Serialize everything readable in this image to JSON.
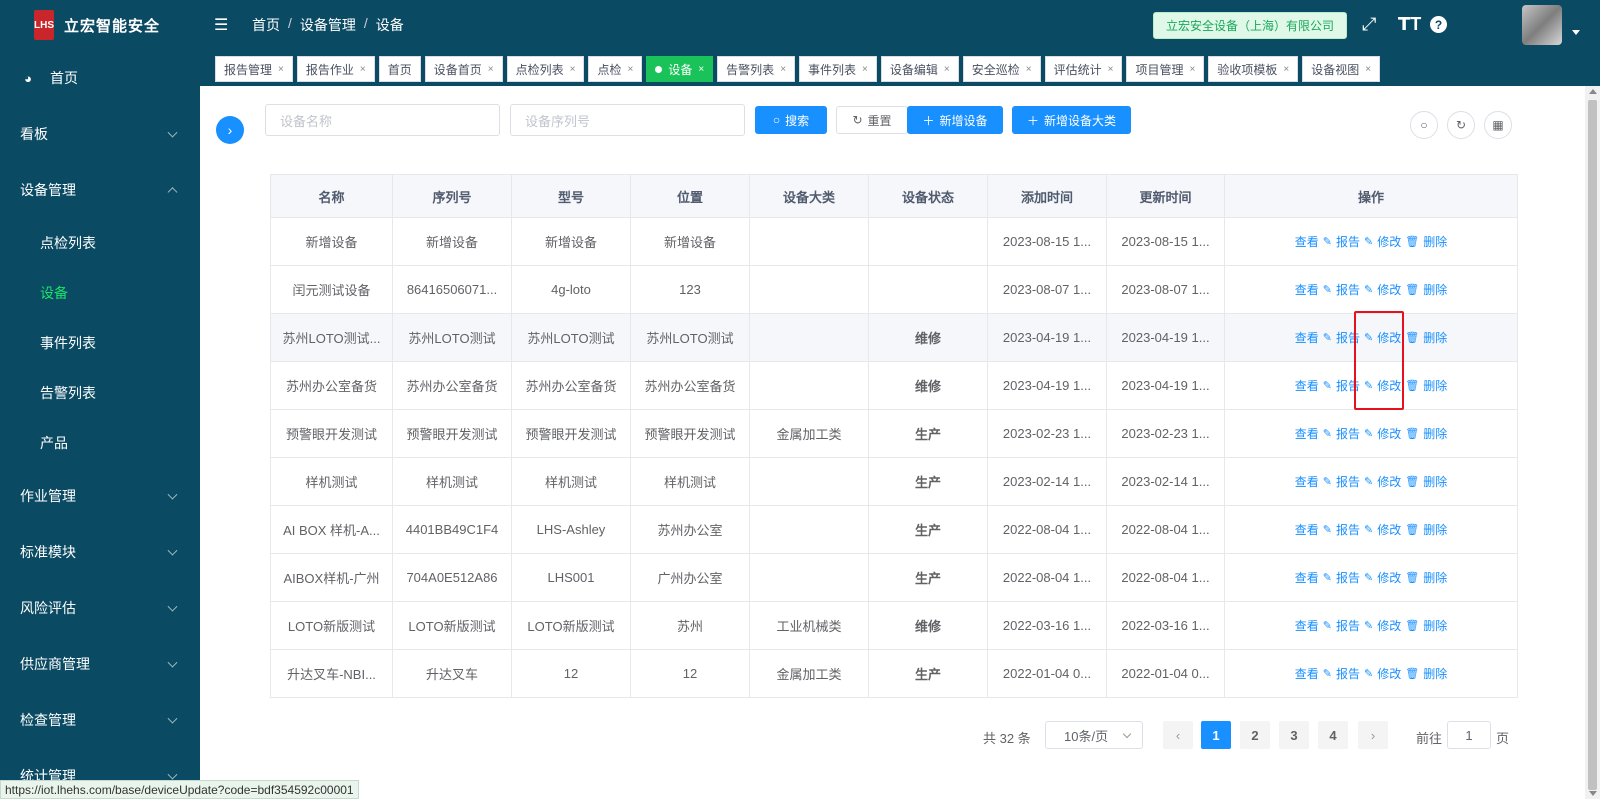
{
  "app": {
    "title": "立宏智能安全",
    "logo_text": "LHS"
  },
  "sidebar": {
    "items": [
      {
        "label": "首页",
        "icon": "dashboard-icon",
        "type": "top"
      },
      {
        "label": "看板",
        "type": "group",
        "expanded": false
      },
      {
        "label": "设备管理",
        "type": "group",
        "expanded": true
      },
      {
        "label": "点检列表",
        "type": "sub"
      },
      {
        "label": "设备",
        "type": "sub",
        "active": true
      },
      {
        "label": "事件列表",
        "type": "sub"
      },
      {
        "label": "告警列表",
        "type": "sub"
      },
      {
        "label": "产品",
        "type": "sub"
      },
      {
        "label": "作业管理",
        "type": "group",
        "expanded": false
      },
      {
        "label": "标准模块",
        "type": "group",
        "expanded": false
      },
      {
        "label": "风险评估",
        "type": "group",
        "expanded": false
      },
      {
        "label": "供应商管理",
        "type": "group",
        "expanded": false
      },
      {
        "label": "检查管理",
        "type": "group",
        "expanded": false
      },
      {
        "label": "统计管理",
        "type": "group",
        "expanded": false
      }
    ]
  },
  "header": {
    "breadcrumb": [
      "首页",
      "设备管理",
      "设备"
    ],
    "company": "立宏安全设备（上海）有限公司"
  },
  "tabs": [
    {
      "label": "报告管理"
    },
    {
      "label": "报告作业"
    },
    {
      "label": "首页",
      "closable": false
    },
    {
      "label": "设备首页"
    },
    {
      "label": "点检列表"
    },
    {
      "label": "点检"
    },
    {
      "label": "设备",
      "active": true
    },
    {
      "label": "告警列表"
    },
    {
      "label": "事件列表"
    },
    {
      "label": "设备编辑"
    },
    {
      "label": "安全巡检"
    },
    {
      "label": "评估统计"
    },
    {
      "label": "项目管理"
    },
    {
      "label": "验收项模板"
    },
    {
      "label": "设备视图"
    }
  ],
  "search": {
    "name_placeholder": "设备名称",
    "serial_placeholder": "设备序列号",
    "search_label": "搜索",
    "reset_label": "重置",
    "add_device_label": "新增设备",
    "add_category_label": "新增设备大类"
  },
  "table": {
    "columns": [
      "名称",
      "序列号",
      "型号",
      "位置",
      "设备大类",
      "设备状态",
      "添加时间",
      "更新时间",
      "操作"
    ],
    "ops": {
      "view": "查看",
      "report": "报告",
      "edit": "修改",
      "delete": "删除"
    },
    "rows": [
      [
        "新增设备",
        "新增设备",
        "新增设备",
        "新增设备",
        "",
        "",
        "2023-08-15 1...",
        "2023-08-15 1..."
      ],
      [
        "闰元测试设备",
        "86416506071...",
        "4g-loto",
        "123",
        "",
        "",
        "2023-08-07 1...",
        "2023-08-07 1..."
      ],
      [
        "苏州LOTO测试...",
        "苏州LOTO测试",
        "苏州LOTO测试",
        "苏州LOTO测试",
        "",
        "维修",
        "2023-04-19 1...",
        "2023-04-19 1..."
      ],
      [
        "苏州办公室备货",
        "苏州办公室备货",
        "苏州办公室备货",
        "苏州办公室备货",
        "",
        "维修",
        "2023-04-19 1...",
        "2023-04-19 1..."
      ],
      [
        "预警眼开发测试",
        "预警眼开发测试",
        "预警眼开发测试",
        "预警眼开发测试",
        "金属加工类",
        "生产",
        "2023-02-23 1...",
        "2023-02-23 1..."
      ],
      [
        "样机测试",
        "样机测试",
        "样机测试",
        "样机测试",
        "",
        "生产",
        "2023-02-14 1...",
        "2023-02-14 1..."
      ],
      [
        "AI BOX 样机-A...",
        "4401BB49C1F4",
        "LHS-Ashley",
        "苏州办公室",
        "",
        "生产",
        "2022-08-04 1...",
        "2022-08-04 1..."
      ],
      [
        "AIBOX样机-广州",
        "704A0E512A86",
        "LHS001",
        "广州办公室",
        "",
        "生产",
        "2022-08-04 1...",
        "2022-08-04 1..."
      ],
      [
        "LOTO新版测试",
        "LOTO新版测试",
        "LOTO新版测试",
        "苏州",
        "工业机械类",
        "维修",
        "2022-03-16 1...",
        "2022-03-16 1..."
      ],
      [
        "升达叉车-NBI...",
        "升达叉车",
        "12",
        "12",
        "金属加工类",
        "生产",
        "2022-01-04 0...",
        "2022-01-04 0..."
      ]
    ]
  },
  "pagination": {
    "total": "共 32 条",
    "page_size": "10条/页",
    "pages": [
      "1",
      "2",
      "3",
      "4"
    ],
    "current": "1",
    "goto_label": "前往",
    "goto_value": "1",
    "page_unit": "页"
  },
  "statusbar": {
    "url": "https://iot.lhehs.com/base/deviceUpdate?code=bdf354592c00001"
  },
  "colors": {
    "sidebar": "#0b4a63",
    "accent": "#1890ff",
    "active_green": "#19c35a",
    "status_repair": "#e6c800",
    "status_production": "#19b34a"
  }
}
